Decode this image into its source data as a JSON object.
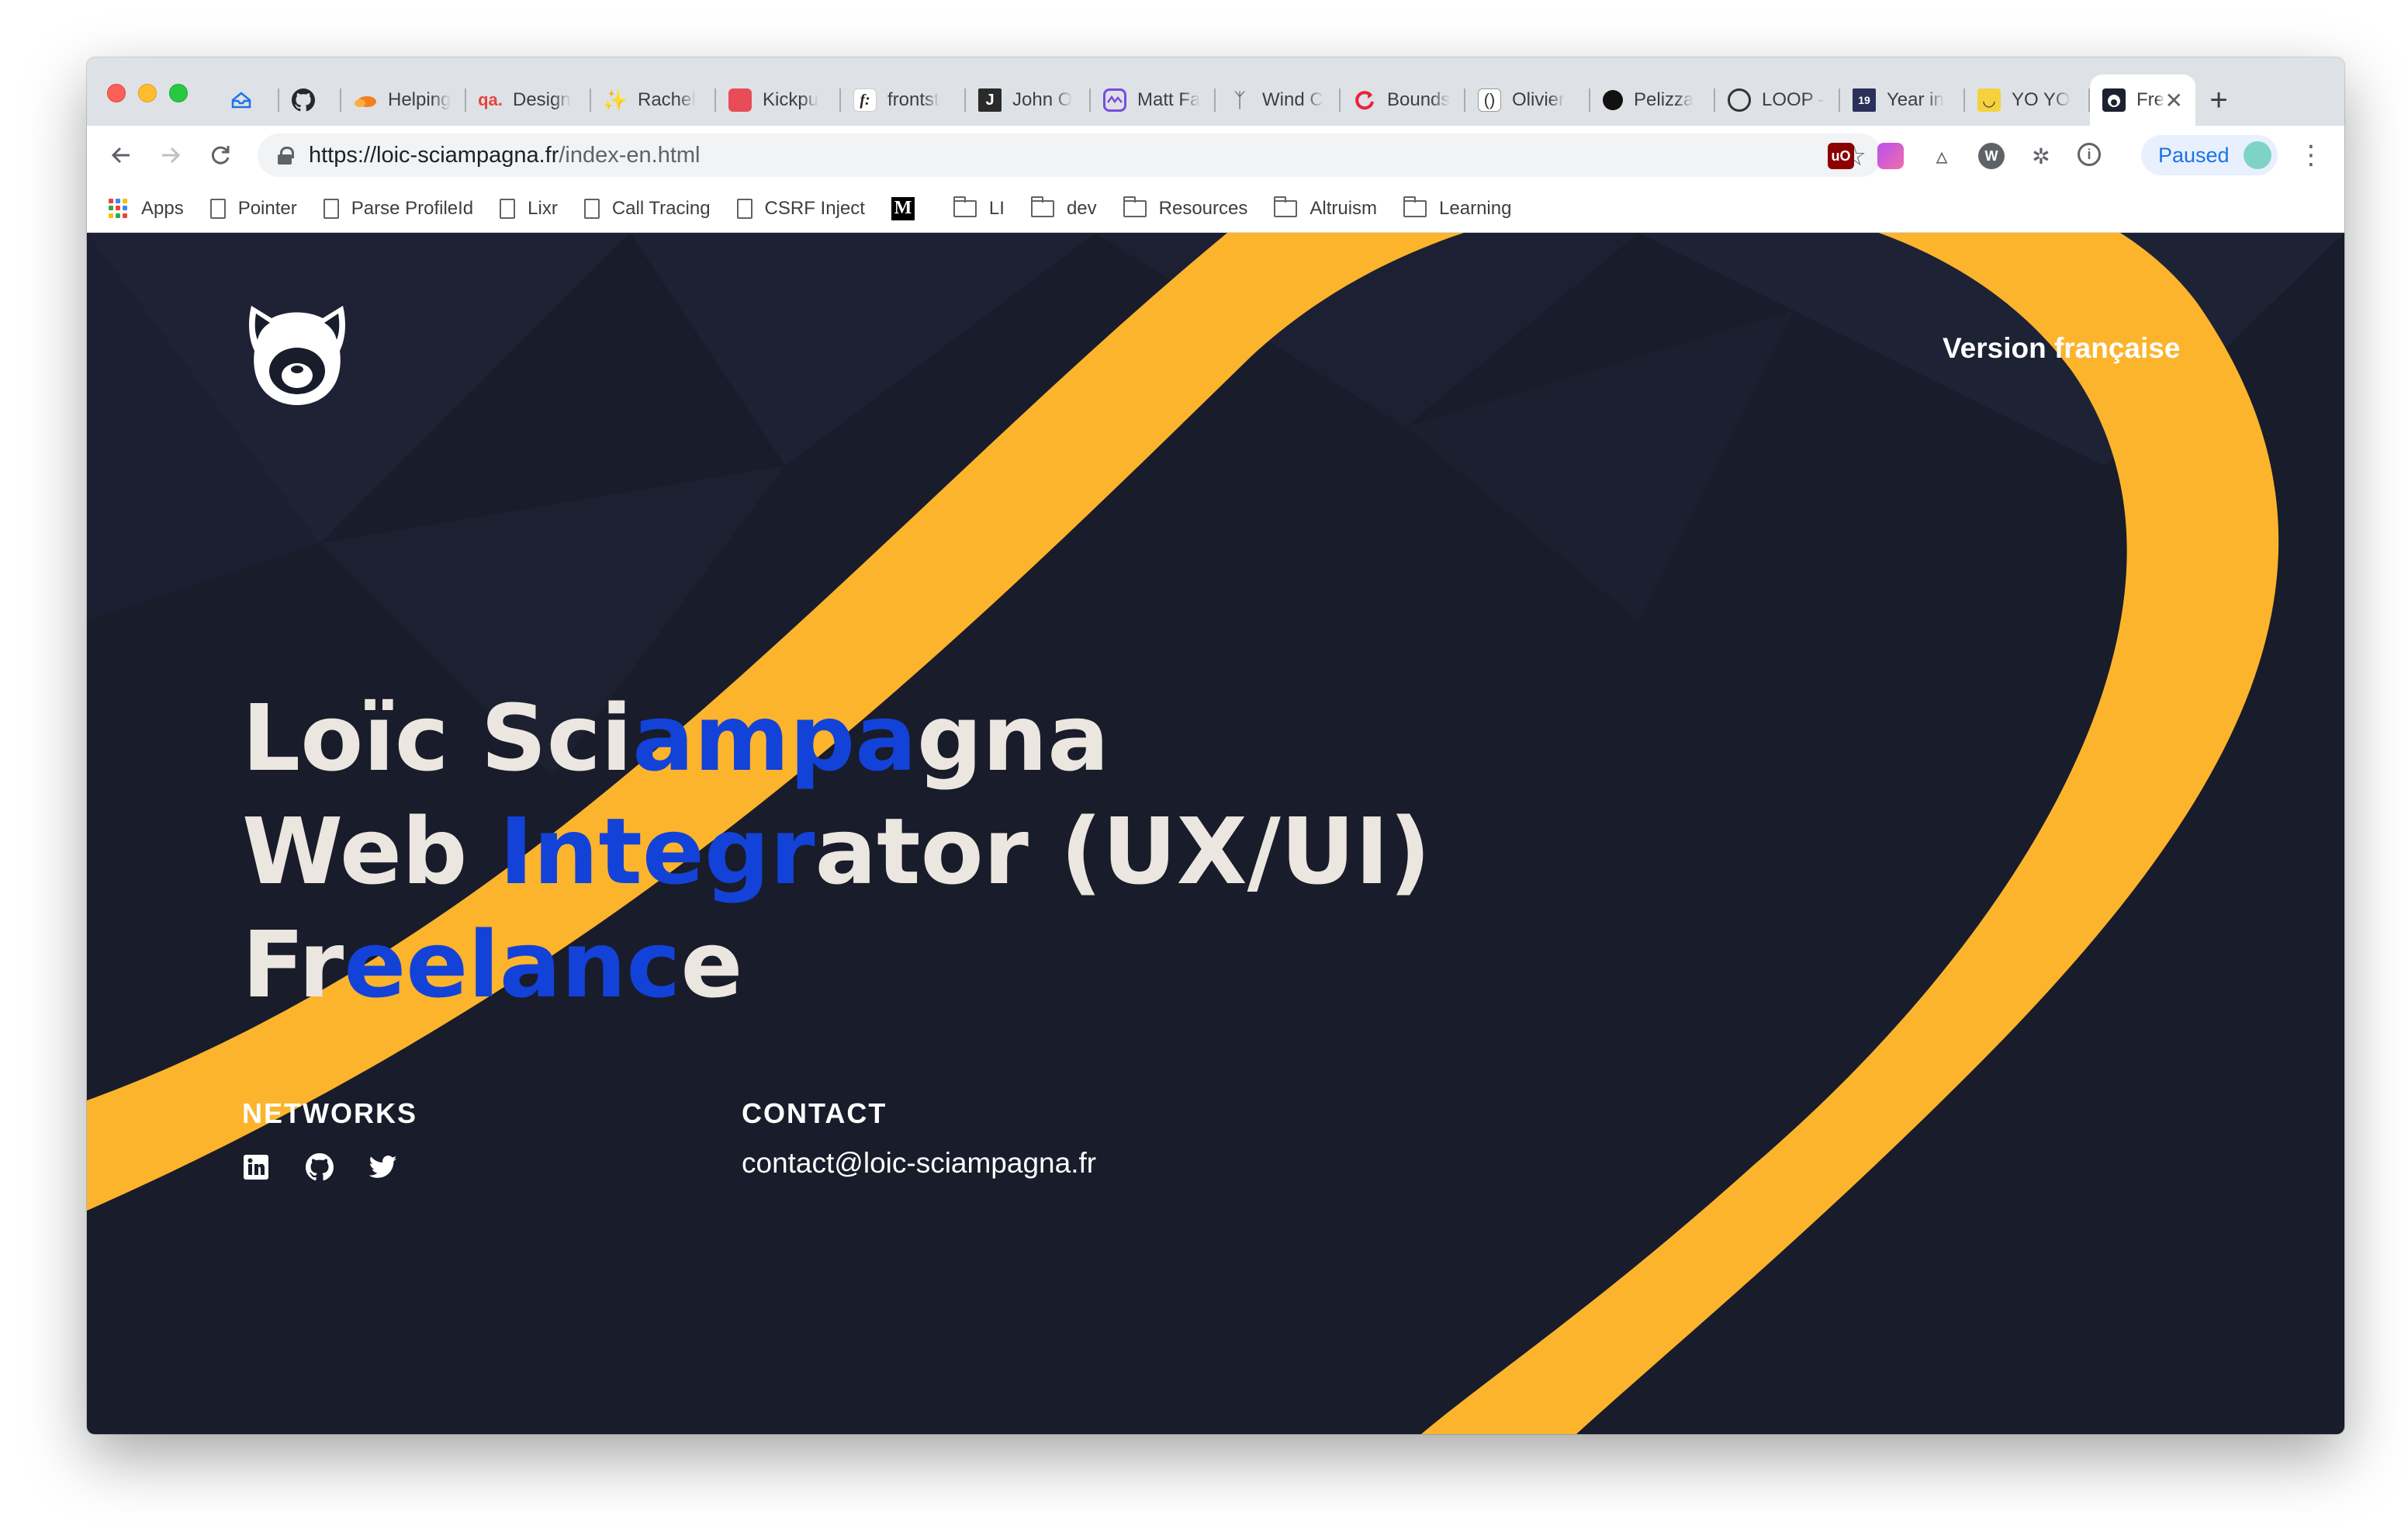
{
  "browser": {
    "tabs": [
      {
        "title": "",
        "favicon": "inbox-icon",
        "color": "#1a73e8"
      },
      {
        "title": "",
        "favicon": "github-icon",
        "color": "#24292e"
      },
      {
        "title": "Helping",
        "favicon": "cloudflare-icon",
        "color": "#f38020"
      },
      {
        "title": "Design",
        "favicon": "qa-icon",
        "color": "#e8453c"
      },
      {
        "title": "Rachel",
        "favicon": "sparkle-icon",
        "color": "#f6c344"
      },
      {
        "title": "Kickpu",
        "favicon": "kickpush-icon",
        "color": "#e84c57"
      },
      {
        "title": "frontst",
        "favicon": "frontstuff-icon",
        "color": "#ffffff"
      },
      {
        "title": "John O",
        "favicon": "j-icon",
        "color": "#2b2b2b"
      },
      {
        "title": "Matt Fa",
        "favicon": "chart-icon",
        "color": "#7b4ce0"
      },
      {
        "title": "Wind C",
        "favicon": "windmill-icon",
        "color": "#555555"
      },
      {
        "title": "Bounds",
        "favicon": "refresh-icon",
        "color": "#e8233a"
      },
      {
        "title": "Olivier",
        "favicon": "brackets-icon",
        "color": "#444444"
      },
      {
        "title": "Pelizza",
        "favicon": "dot-icon",
        "color": "#111111"
      },
      {
        "title": "LOOP -",
        "favicon": "circle-icon",
        "color": "#333333"
      },
      {
        "title": "Year in",
        "favicon": "year-icon",
        "color": "#2b2f5a"
      },
      {
        "title": "YO YO",
        "favicon": "smile-icon",
        "color": "#f5d23d"
      }
    ],
    "active_tab": {
      "title": "Fre",
      "favicon": "panda-icon"
    },
    "new_tab_label": "+",
    "url_host": "https://loic-sciampagna.fr",
    "url_path": "/index-en.html",
    "paused_label": "Paused",
    "bookmarks": [
      {
        "label": "Apps",
        "icon": "apps-icon"
      },
      {
        "label": "Pointer",
        "icon": "page-icon"
      },
      {
        "label": "Parse ProfileId",
        "icon": "page-icon"
      },
      {
        "label": "Lixr",
        "icon": "page-icon"
      },
      {
        "label": "Call Tracing",
        "icon": "page-icon"
      },
      {
        "label": "CSRF Inject",
        "icon": "page-icon"
      },
      {
        "label": "",
        "icon": "medium-icon"
      },
      {
        "label": "LI",
        "icon": "folder-icon"
      },
      {
        "label": "dev",
        "icon": "folder-icon"
      },
      {
        "label": "Resources",
        "icon": "folder-icon"
      },
      {
        "label": "Altruism",
        "icon": "folder-icon"
      },
      {
        "label": "Learning",
        "icon": "folder-icon"
      }
    ]
  },
  "page": {
    "language_link": "Version française",
    "hero": {
      "line1": [
        "Loïc Sci",
        "ampa",
        "gna"
      ],
      "line2": [
        "Web ",
        "Integr",
        "ator (UX/UI)"
      ],
      "line3": [
        "Fr",
        "eelanc",
        "e"
      ]
    },
    "networks_title": "NETWORKS",
    "networks": [
      "linkedin-icon",
      "github-icon",
      "twitter-icon"
    ],
    "contact_title": "CONTACT",
    "contact_email": "contact@loic-sciampagna.fr",
    "colors": {
      "background": "#191c2a",
      "ribbon": "#fbb42c",
      "accent": "#1342d8",
      "text": "#ebe6df"
    }
  }
}
